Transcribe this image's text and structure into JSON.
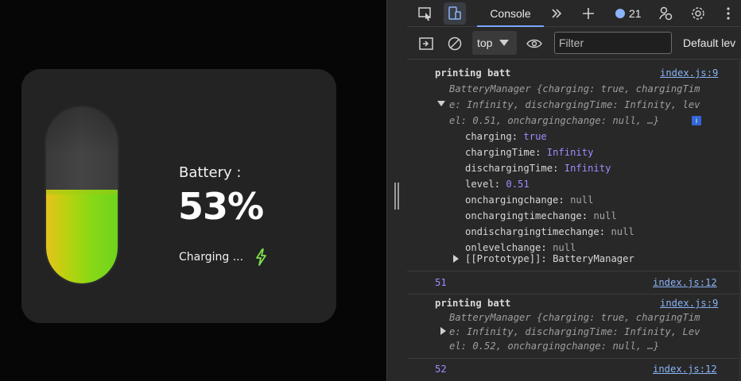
{
  "preview": {
    "battery_label": "Battery :",
    "battery_value": "53%",
    "battery_level": 0.53,
    "charging_text": "Charging ...",
    "icon": "bolt-icon",
    "colors": {
      "card": "#232323",
      "fill_start": "#e6c21a",
      "fill_end": "#6fd41c",
      "bolt": "#7ee04a"
    }
  },
  "devtools": {
    "tab_label": "Console",
    "issues_count": "21",
    "context": "top",
    "filter_placeholder": "Filter",
    "levels_label": "Default lev",
    "icons": [
      "inspect-icon",
      "device-toolbar-icon",
      "more-tabs-icon",
      "plus-icon",
      "issues-icon",
      "customize-icon",
      "settings-icon",
      "kebab-icon",
      "sidebar-toggle-icon",
      "clear-icon",
      "eye-icon"
    ]
  },
  "console": {
    "msg1": {
      "title": "printing batt",
      "source": "index.js:9",
      "summary_line1": "BatteryManager {charging: true, chargingTim",
      "summary_line2": "e: Infinity, dischargingTime: Infinity, lev",
      "summary_line3": "el: 0.51, onchargingchange: null, …}",
      "props": [
        {
          "key": "charging",
          "value": "true"
        },
        {
          "key": "chargingTime",
          "value": "Infinity"
        },
        {
          "key": "dischargingTime",
          "value": "Infinity"
        },
        {
          "key": "level",
          "value": "0.51"
        },
        {
          "key": "onchargingchange",
          "value": "null"
        },
        {
          "key": "onchargingtimechange",
          "value": "null"
        },
        {
          "key": "ondischargingtimechange",
          "value": "null"
        },
        {
          "key": "onlevelchange",
          "value": "null"
        }
      ],
      "prototype_key": "[[Prototype]]",
      "prototype_value": "BatteryManager"
    },
    "msg2": {
      "text": "51",
      "source": "index.js:12"
    },
    "msg3": {
      "title": "printing batt",
      "source": "index.js:9",
      "summary_line1": "BatteryManager {charging: true, chargingTim",
      "summary_line2": "e: Infinity, dischargingTime: Infinity, Lev",
      "summary_line3": "el: 0.52, onchargingchange: null, …}"
    },
    "msg4": {
      "text": "52",
      "source": "index.js:12"
    }
  }
}
